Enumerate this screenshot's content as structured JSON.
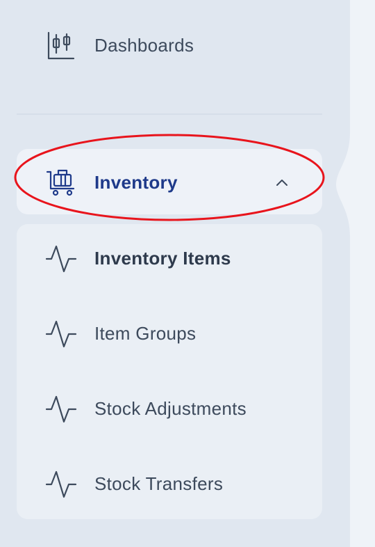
{
  "sidebar": {
    "dashboards": {
      "label": "Dashboards",
      "icon": "candlestick-chart-icon"
    },
    "inventory": {
      "label": "Inventory",
      "icon": "luggage-cart-icon",
      "expanded": true
    },
    "inventory_items": [
      {
        "label": "Inventory Items",
        "icon": "activity-pulse-icon",
        "active": true
      },
      {
        "label": "Item Groups",
        "icon": "activity-pulse-icon",
        "active": false
      },
      {
        "label": "Stock Adjustments",
        "icon": "activity-pulse-icon",
        "active": false
      },
      {
        "label": "Stock Transfers",
        "icon": "activity-pulse-icon",
        "active": false
      }
    ]
  },
  "colors": {
    "active_section": "#1e3a8a",
    "text": "#3d4a5c",
    "highlight_annotation": "#e8141c"
  }
}
